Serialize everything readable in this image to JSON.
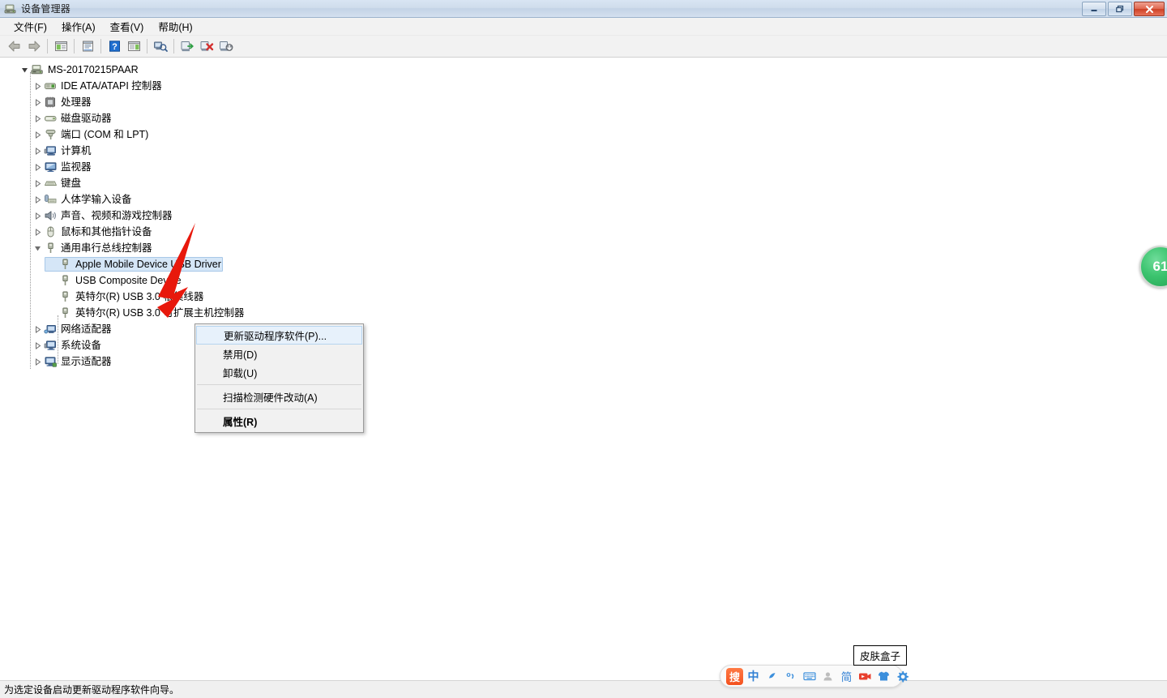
{
  "window": {
    "title": "设备管理器",
    "icon": "device-manager-icon",
    "controls": {
      "minimize": "最小化",
      "maximize": "最大化",
      "close": "关闭"
    }
  },
  "menubar": {
    "items": [
      {
        "label": "文件(F)",
        "name": "menu-file"
      },
      {
        "label": "操作(A)",
        "name": "menu-action"
      },
      {
        "label": "查看(V)",
        "name": "menu-view"
      },
      {
        "label": "帮助(H)",
        "name": "menu-help"
      }
    ]
  },
  "toolbar": {
    "buttons": [
      {
        "name": "back-icon",
        "tip": "后退"
      },
      {
        "name": "forward-icon",
        "tip": "前进"
      },
      {
        "name": "show-hide-console-tree-icon",
        "tip": "显示/隐藏控制台树"
      },
      {
        "name": "properties-icon",
        "tip": "属性"
      },
      {
        "name": "help-icon",
        "tip": "帮助"
      },
      {
        "name": "view-list-icon",
        "tip": "查看"
      },
      {
        "name": "scan-hardware-changes-icon",
        "tip": "扫描检测硬件改动"
      },
      {
        "name": "update-driver-icon",
        "tip": "更新驱动程序软件"
      },
      {
        "name": "uninstall-device-icon",
        "tip": "卸载"
      },
      {
        "name": "disable-device-icon",
        "tip": "禁用"
      }
    ]
  },
  "tree": {
    "root": {
      "label": "MS-20170215PAAR",
      "icon": "computer-root-icon",
      "expanded": true
    },
    "nodes": [
      {
        "label": "IDE ATA/ATAPI 控制器",
        "icon": "ide-controller-icon",
        "level": 1,
        "expandable": true,
        "expanded": false
      },
      {
        "label": "处理器",
        "icon": "processor-icon",
        "level": 1,
        "expandable": true,
        "expanded": false
      },
      {
        "label": "磁盘驱动器",
        "icon": "disk-drive-icon",
        "level": 1,
        "expandable": true,
        "expanded": false
      },
      {
        "label": "端口 (COM 和 LPT)",
        "icon": "ports-icon",
        "level": 1,
        "expandable": true,
        "expanded": false
      },
      {
        "label": "计算机",
        "icon": "computer-icon",
        "level": 1,
        "expandable": true,
        "expanded": false
      },
      {
        "label": "监视器",
        "icon": "monitor-icon",
        "level": 1,
        "expandable": true,
        "expanded": false
      },
      {
        "label": "键盘",
        "icon": "keyboard-icon",
        "level": 1,
        "expandable": true,
        "expanded": false
      },
      {
        "label": "人体学输入设备",
        "icon": "hid-icon",
        "level": 1,
        "expandable": true,
        "expanded": false
      },
      {
        "label": "声音、视频和游戏控制器",
        "icon": "sound-video-game-icon",
        "level": 1,
        "expandable": true,
        "expanded": false
      },
      {
        "label": "鼠标和其他指针设备",
        "icon": "mouse-icon",
        "level": 1,
        "expandable": true,
        "expanded": false
      },
      {
        "label": "通用串行总线控制器",
        "icon": "usb-controller-icon",
        "level": 1,
        "expandable": true,
        "expanded": true
      },
      {
        "label": "Apple Mobile Device USB Driver",
        "icon": "usb-device-icon",
        "level": 2,
        "expandable": false,
        "selected": true
      },
      {
        "label": "USB Composite Device",
        "icon": "usb-device-icon",
        "level": 2,
        "expandable": false
      },
      {
        "label": "英特尔(R) USB 3.0 根集线器",
        "icon": "usb-device-icon",
        "level": 2,
        "expandable": false
      },
      {
        "label": "英特尔(R) USB 3.0 可扩展主机控制器",
        "icon": "usb-device-icon",
        "level": 2,
        "expandable": false
      },
      {
        "label": "网络适配器",
        "icon": "network-adapter-icon",
        "level": 1,
        "expandable": true,
        "expanded": false
      },
      {
        "label": "系统设备",
        "icon": "system-device-icon",
        "level": 1,
        "expandable": true,
        "expanded": false
      },
      {
        "label": "显示适配器",
        "icon": "display-adapter-icon",
        "level": 1,
        "expandable": true,
        "expanded": false
      }
    ]
  },
  "context_menu": {
    "items": [
      {
        "label": "更新驱动程序软件(P)...",
        "name": "ctx-update-driver",
        "highlighted": true,
        "bold": false
      },
      {
        "label": "禁用(D)",
        "name": "ctx-disable",
        "highlighted": false,
        "bold": false
      },
      {
        "label": "卸载(U)",
        "name": "ctx-uninstall",
        "highlighted": false,
        "bold": false
      },
      {
        "separator": true
      },
      {
        "label": "扫描检测硬件改动(A)",
        "name": "ctx-scan-hardware",
        "highlighted": false,
        "bold": false
      },
      {
        "separator": true
      },
      {
        "label": "属性(R)",
        "name": "ctx-properties",
        "highlighted": false,
        "bold": true
      }
    ]
  },
  "statusbar": {
    "text": "为选定设备启动更新驱动程序软件向导。"
  },
  "badge": {
    "value": "61",
    "color": "#3cc46f"
  },
  "ime": {
    "logo": "搜",
    "items": [
      {
        "name": "ime-logo",
        "glyph": "搜"
      },
      {
        "name": "ime-chinese-mode",
        "glyph": "中"
      },
      {
        "name": "ime-moon-icon",
        "glyph": "☽"
      },
      {
        "name": "ime-punctuation-icon",
        "glyph": "°,"
      },
      {
        "name": "ime-soft-keyboard-icon",
        "glyph": "⌨"
      },
      {
        "name": "ime-user-icon",
        "glyph": "👤"
      },
      {
        "name": "ime-simplified-icon",
        "glyph": "简"
      },
      {
        "name": "ime-video-icon",
        "glyph": "▶"
      },
      {
        "name": "ime-skin-icon",
        "glyph": "👕"
      },
      {
        "name": "ime-settings-icon",
        "glyph": "⚙"
      }
    ]
  },
  "tooltip": {
    "skin_box": "皮肤盒子"
  }
}
